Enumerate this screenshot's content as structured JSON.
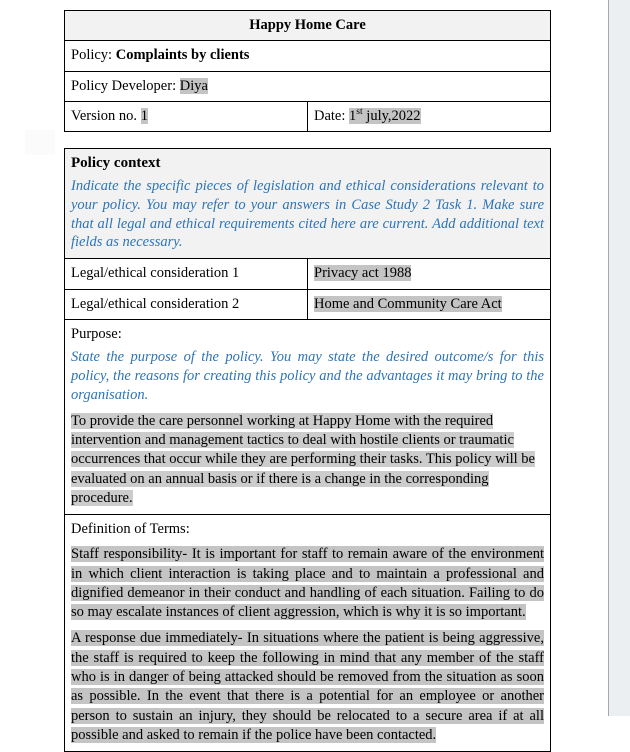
{
  "document": {
    "org_title": "Happy Home Care",
    "info": {
      "policy_label": "Policy:",
      "policy_value": "Complaints by clients",
      "developer_label": "Policy Developer:",
      "developer_value": "Diya",
      "version_label": "Version no.",
      "version_value": "1",
      "date_label": "Date:",
      "date_value_num": "1",
      "date_value_sup": "st",
      "date_value_rest": " july,2022"
    },
    "context": {
      "heading": "Policy context",
      "hint": "Indicate the specific pieces of legislation and ethical considerations relevant to your policy. You may refer to your answers in Case Study 2 Task 1. Make sure that all legal and ethical requirements cited here are current. Add additional text fields as necessary.",
      "considerations": [
        {
          "label": "Legal/ethical consideration 1",
          "value": "Privacy act 1988"
        },
        {
          "label": "Legal/ethical consideration 2",
          "value": "Home and Community Care Act"
        }
      ]
    },
    "purpose": {
      "label": "Purpose:",
      "hint": "State the purpose of the policy. You may state the desired outcome/s for this policy, the reasons for creating this policy and the advantages it may bring to the organisation.",
      "body": "To provide the care personnel working at Happy Home with the required intervention and management tactics to deal with hostile clients or traumatic occurrences that occur while they are performing their tasks. This policy will be evaluated on an annual basis or if there is a change in the corresponding procedure."
    },
    "definitions": {
      "label": "Definition of Terms:",
      "paragraphs": [
        "Staff responsibility- It is important for staff to remain aware of the environment in which client interaction is taking place and to maintain a professional and dignified demeanor in their conduct and handling of each situation. Failing to do so may escalate instances of client aggression, which is why it is so important.",
        "A response due immediately- In situations where the patient is being aggressive, the staff is required to keep the following in mind that any member of the staff who is in danger of being attacked should be removed from the situation as soon as possible. In the event that there is a potential for an employee or another person to sustain an injury, they should be relocated to a secure area if at all possible and asked to remain if the police have been contacted."
      ]
    }
  },
  "colors": {
    "hint_blue": "#2e74b5",
    "header_fill": "#f2f2f2",
    "highlight": "#c4c4c4",
    "border": "#000000"
  }
}
